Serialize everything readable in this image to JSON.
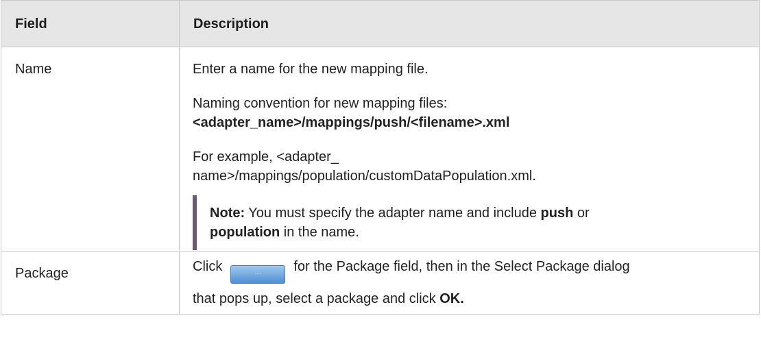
{
  "table": {
    "header": {
      "field": "Field",
      "description": "Description"
    },
    "rows": {
      "name": {
        "field": "Name",
        "desc1": "Enter a name for the new mapping file.",
        "desc2_text": "Naming convention for new mapping files:",
        "desc2_bold": "<adapter_name>/mappings/push/<filename>.xml",
        "desc3_line1": "For example, <adapter_",
        "desc3_line2": "name>/mappings/population/customDataPopulation.xml.",
        "note_label": "Note:",
        "note_text1": " You must specify the adapter name and include ",
        "note_bold1": "push",
        "note_text2": " or",
        "note_bold2": "population",
        "note_text3": " in the name."
      },
      "package": {
        "field": "Package",
        "desc_pre": "Click",
        "button_label": "...",
        "desc_post": "for the Package field, then in the Select Package dialog",
        "desc_line2": "that pops up, select a package and click ",
        "desc_bold": "OK."
      }
    }
  },
  "colors": {
    "header_bg": "#e6e6e6",
    "note_bar": "#6b5878",
    "button": "#4f8fd3"
  }
}
